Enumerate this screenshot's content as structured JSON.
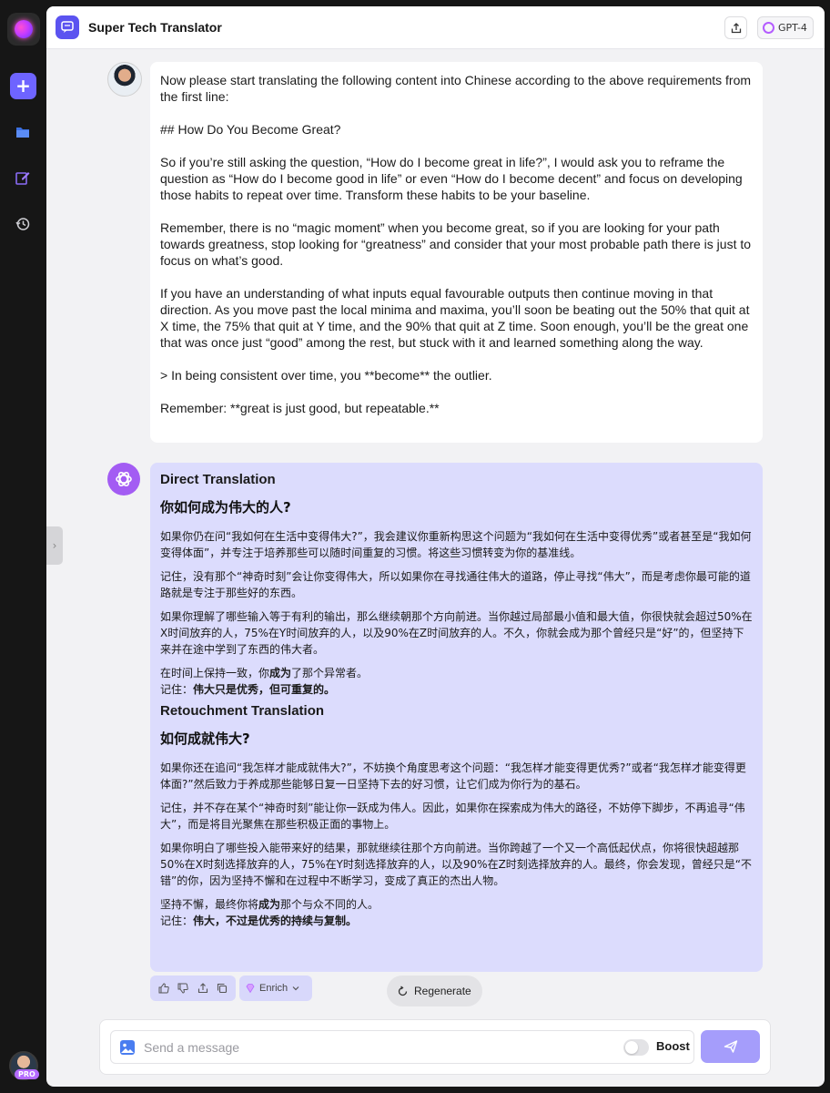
{
  "app": {
    "title": "Super Tech Translator",
    "model": "GPT-4",
    "accent": "#5b53f0"
  },
  "sidebar": {
    "items": [
      {
        "icon": "plus-icon"
      },
      {
        "icon": "folder-icon"
      },
      {
        "icon": "edit-icon"
      },
      {
        "icon": "history-icon"
      }
    ],
    "badge": "PRO"
  },
  "user_message": {
    "paragraphs": [
      "Now please start translating the following content into Chinese according to the above requirements from the first line:",
      "## How Do You Become Great?",
      "So if you’re still asking the question, “How do I become great in life?”, I would ask you to reframe the question as “How do I become good in life” or even “How do I become decent” and focus on developing those habits to repeat over time. Transform these habits to be your baseline.",
      "Remember, there is no “magic moment” when you become great, so if you are looking for your path towards greatness, stop looking for “greatness” and consider that your most probable path there is just to focus on what’s good.",
      "If you have an understanding of what inputs equal favourable outputs then continue moving in that direction. As you move past the local minima and maxima, you’ll soon be beating out the 50% that quit at X time, the 75% that quit at Y time, and the 90% that quit at Z time. Soon enough, you’ll be the great one that was once just “good” among the rest, but stuck with it and learned something along the way.",
      "> In being consistent over time, you **become** the outlier.",
      "Remember: **great is just good, but repeatable.**"
    ]
  },
  "ai_message": {
    "direct": {
      "label": "Direct Translation",
      "heading": "你如何成为伟大的人?",
      "p1": "如果你仍在问“我如何在生活中变得伟大?”，我会建议你重新构思这个问题为“我如何在生活中变得优秀”或者甚至是“我如何变得体面”，并专注于培养那些可以随时间重复的习惯。将这些习惯转变为你的基准线。",
      "p2": "记住，没有那个“神奇时刻”会让你变得伟大，所以如果你在寻找通往伟大的道路，停止寻找“伟大”，而是考虑你最可能的道路就是专注于那些好的东西。",
      "p3": "如果你理解了哪些输入等于有利的输出，那么继续朝那个方向前进。当你越过局部最小值和最大值，你很快就会超过50%在X时间放弃的人，75%在Y时间放弃的人，以及90%在Z时间放弃的人。不久，你就会成为那个曾经只是“好”的，但坚持下来并在途中学到了东西的伟大者。",
      "p4_pre": "在时间上保持一致，你",
      "p4_bold": "成为",
      "p4_post": "了那个异常者。",
      "p5_pre": "记住：",
      "p5_bold": "伟大只是优秀，但可重复的。"
    },
    "retouch": {
      "label": "Retouchment Translation",
      "heading": "如何成就伟大?",
      "p1": "如果你还在追问“我怎样才能成就伟大?”，不妨换个角度思考这个问题：“我怎样才能变得更优秀?”或者“我怎样才能变得更体面?”然后致力于养成那些能够日复一日坚持下去的好习惯，让它们成为你行为的基石。",
      "p2": "记住，并不存在某个“神奇时刻”能让你一跃成为伟人。因此，如果你在探索成为伟大的路径，不妨停下脚步，不再追寻“伟大”，而是将目光聚焦在那些积极正面的事物上。",
      "p3": "如果你明白了哪些投入能带来好的结果，那就继续往那个方向前进。当你跨越了一个又一个高低起伏点，你将很快超越那50%在X时刻选择放弃的人，75%在Y时刻选择放弃的人，以及90%在Z时刻选择放弃的人。最终，你会发现，曾经只是“不错”的你，因为坚持不懈和在过程中不断学习，变成了真正的杰出人物。",
      "p4_pre": "坚持不懈，最终你将",
      "p4_bold": "成为",
      "p4_post": "那个与众不同的人。",
      "p5_pre": "记住：",
      "p5_bold": "伟大，不过是优秀的持续与复制。"
    }
  },
  "actions": {
    "enrich_label": "Enrich",
    "regenerate_label": "Regenerate"
  },
  "composer": {
    "placeholder": "Send a message",
    "boost_label": "Boost",
    "boost_on": false
  }
}
